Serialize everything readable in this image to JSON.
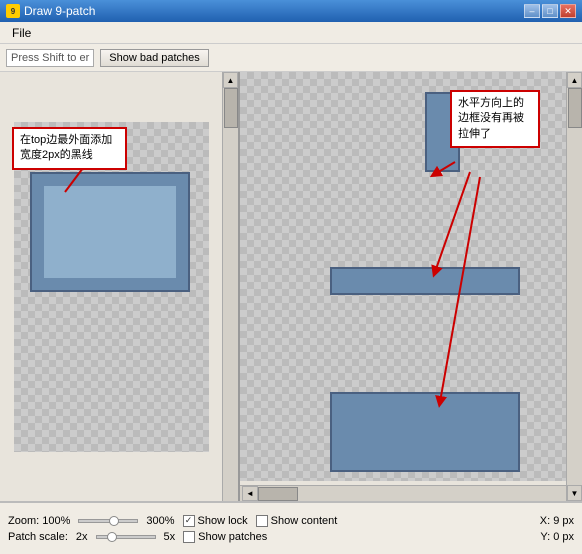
{
  "window": {
    "title": "Draw 9-patch",
    "icon_label": "9"
  },
  "title_buttons": {
    "minimize": "–",
    "maximize": "□",
    "close": "✕"
  },
  "menu": {
    "file_label": "File"
  },
  "toolbar": {
    "hint_text": "Press Shift to er",
    "bad_patches_btn": "Show bad patches"
  },
  "callout_left": {
    "text": "在top边最外面添加宽度2px的黑线"
  },
  "callout_right": {
    "text": "水平方向上的边框没有再被拉伸了"
  },
  "status": {
    "zoom_label": "Zoom: 100%",
    "zoom_max": "300%",
    "show_lock_label": "Show lock",
    "show_content_label": "Show content",
    "patch_scale_label": "Patch scale:",
    "patch_scale_value": "2x",
    "patch_scale_max": "5x",
    "show_patches_label": "Show patches",
    "x_label": "X: 9 px",
    "y_label": "Y: 0 px"
  }
}
